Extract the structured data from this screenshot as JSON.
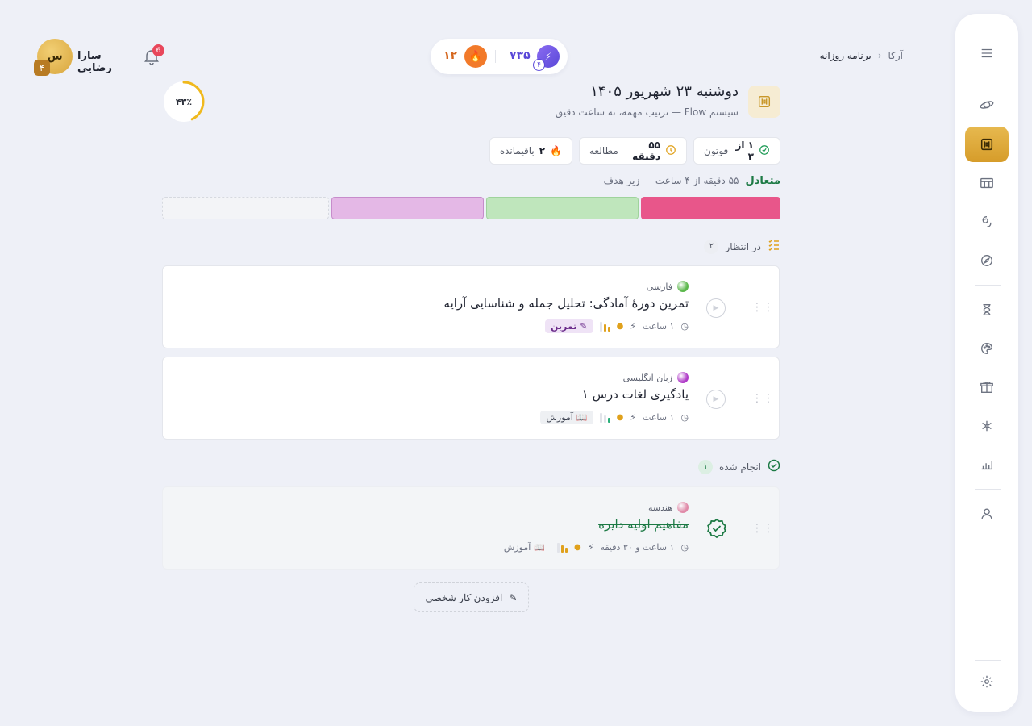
{
  "breadcrumb": {
    "root": "آرکا",
    "current": "برنامه روزانه"
  },
  "stats": {
    "gems": "۷۳۵",
    "gem_level": "۴",
    "streak": "۱۲"
  },
  "user": {
    "name": "سارا رضایی",
    "avatar_text": "س",
    "level": "۴",
    "notifications": "6"
  },
  "progress": {
    "label": "۴۳٪",
    "value": 0.43
  },
  "day": {
    "title": "دوشنبه ۲۳ شهریور ۱۴۰۵",
    "subtitle": "سیستم Flow — ترتیب مهمه، نه ساعت دقیق"
  },
  "chips": {
    "photons": {
      "value": "۱ از ۳",
      "label": "فوتون"
    },
    "study": {
      "value": "۵۵ دقیقه",
      "label": "مطالعه"
    },
    "remaining": {
      "value": "۲",
      "label": "باقیمانده"
    }
  },
  "balance": {
    "status": "متعادل",
    "detail": "۵۵ دقیقه از ۴ ساعت — زیر هدف"
  },
  "segments": [
    {
      "color": "#e8568a"
    },
    {
      "color": "#bfe6bc"
    },
    {
      "color": "#e4b8e6"
    },
    {
      "color": "#f3f4f7"
    }
  ],
  "pending": {
    "label": "در انتظار",
    "count": "۲"
  },
  "done": {
    "label": "انجام شده",
    "count": "۱"
  },
  "tasks": [
    {
      "subject": "فارسی",
      "subject_color": "#5cb84c",
      "title": "تمرین دورهٔ آمادگی: تحلیل جمله و شناسایی آرایه",
      "duration": "۱ ساعت",
      "tag": "تمرین",
      "tag_bg": "#efe3f6",
      "tag_color": "#6a2a8a"
    },
    {
      "subject": "زبان انگلیسی",
      "subject_color": "#b03cc8",
      "title": "یادگیری لغات درس ۱",
      "duration": "۱ ساعت",
      "tag": "آموزش",
      "tag_bg": "#eef0f3",
      "tag_color": "#3d4250"
    },
    {
      "subject": "هندسه",
      "subject_color": "#e08aa8",
      "title": "مفاهیم اولیه دایره",
      "duration": "۱ ساعت و ۳۰ دقیقه",
      "tag": "آموزش",
      "tag_bg": "transparent",
      "tag_color": "#6b7080"
    }
  ],
  "add_button": "افزودن کار شخصی",
  "sidebar_icons": [
    "menu-icon",
    "planet-icon",
    "daily-plan-icon",
    "table-icon",
    "swirl-icon",
    "compass-icon",
    "hourglass-icon",
    "palette-icon",
    "gift-icon",
    "atom-icon",
    "chart-icon",
    "user-icon",
    "settings-icon"
  ]
}
